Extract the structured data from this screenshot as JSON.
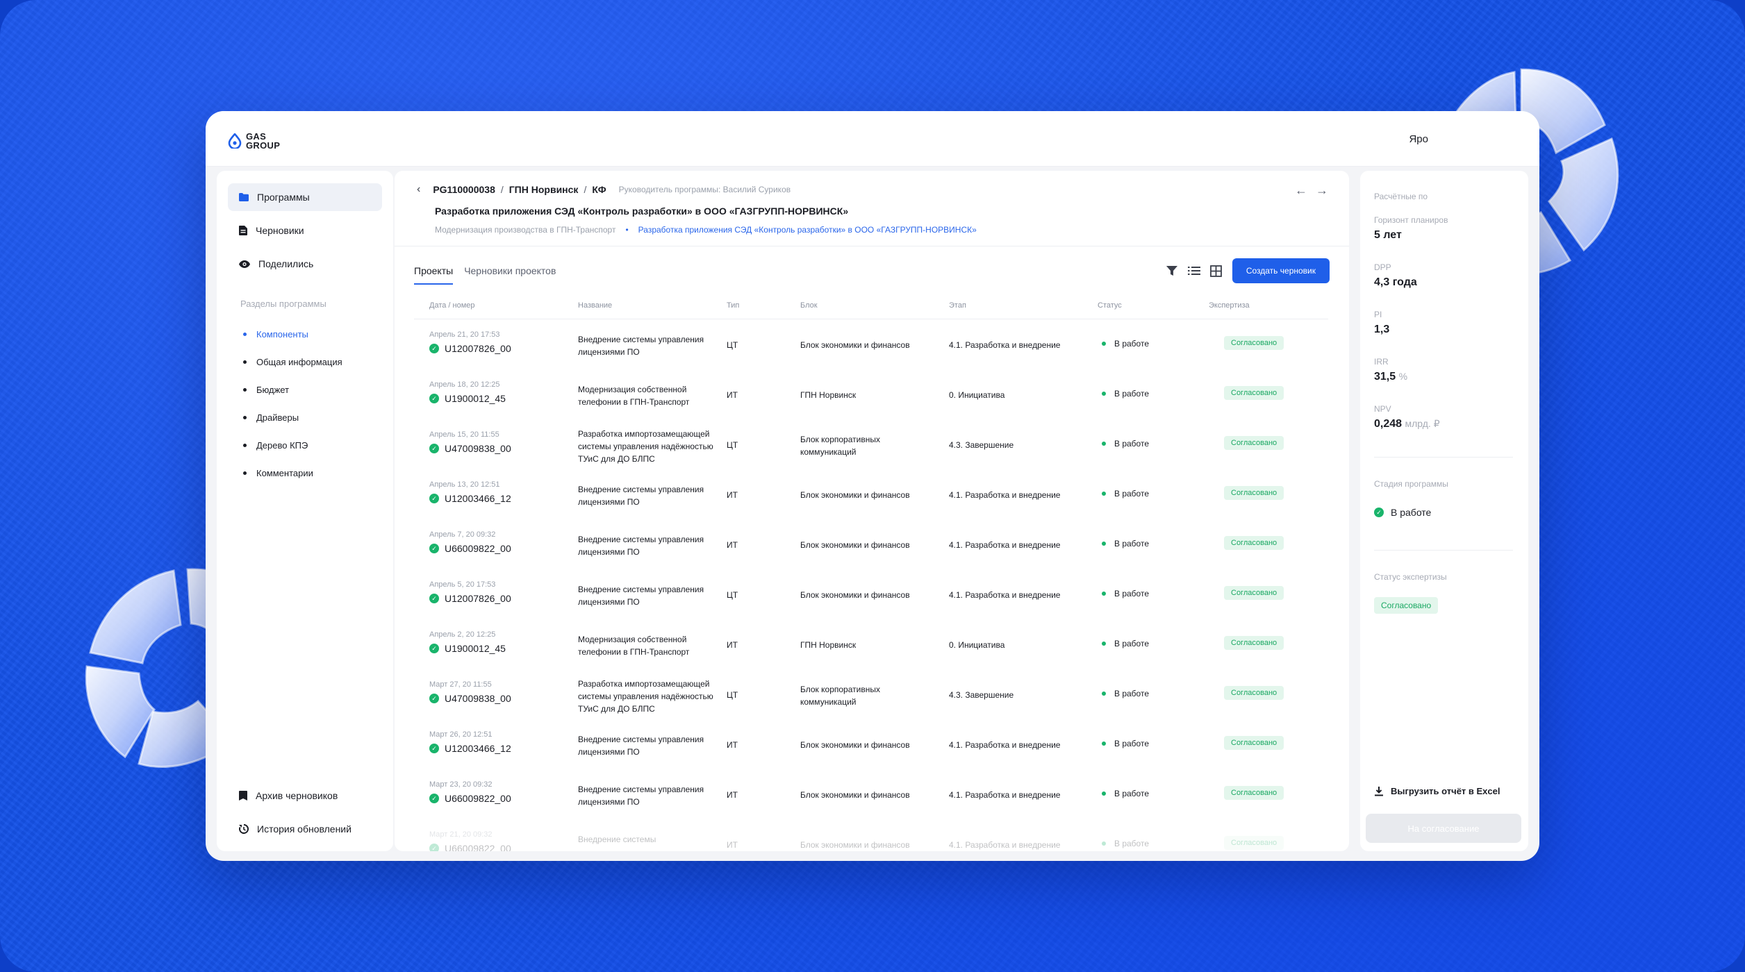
{
  "logo": {
    "text": "GAS\nGROUP"
  },
  "user": {
    "name": "Яро"
  },
  "sidebar": {
    "items": [
      {
        "label": "Программы",
        "icon": "folder-icon"
      },
      {
        "label": "Черновики",
        "icon": "document-icon"
      },
      {
        "label": "Поделились",
        "icon": "eye-icon"
      }
    ],
    "section_caption": "Разделы программы",
    "sections": [
      {
        "label": "Компоненты"
      },
      {
        "label": "Общая информация"
      },
      {
        "label": "Бюджет"
      },
      {
        "label": "Драйверы"
      },
      {
        "label": "Дерево КПЭ"
      },
      {
        "label": "Комментарии"
      }
    ],
    "bottom": [
      {
        "label": "Архив черновиков",
        "icon": "archive-icon"
      },
      {
        "label": "История обновлений",
        "icon": "history-icon"
      }
    ]
  },
  "header": {
    "breadcrumb": [
      "PG110000038",
      "ГПН Норвинск",
      "КФ"
    ],
    "separator": "/",
    "lead": "Руководитель программы: Василий Суриков",
    "title": "Разработка приложения СЭД «Контроль разработки» в ООО «ГАЗГРУПП-НОРВИНСК»",
    "sub_parent": "Модернизация производства в ГПН-Транспорт",
    "sub_link": "Разработка приложения СЭД «Контроль разработки» в ООО «ГАЗГРУПП-НОРВИНСК»"
  },
  "tabs": [
    {
      "label": "Проекты"
    },
    {
      "label": "Черновики проектов"
    }
  ],
  "toolbar": {
    "create_label": "Создать черновик"
  },
  "table": {
    "columns": [
      "Дата / номер",
      "Название",
      "Тип",
      "Блок",
      "Этап",
      "Статус",
      "Экспертиза"
    ],
    "rows": [
      {
        "date": "Апрель 21, 20 17:53",
        "code": "U12007826_00",
        "name": "Внедрение системы управления лицензиями ПО",
        "type": "ЦТ",
        "block": "Блок экономики и финансов",
        "stage": "4.1. Разработка и внедрение",
        "status": "В работе",
        "expertise": "Согласовано"
      },
      {
        "date": "Апрель 18, 20 12:25",
        "code": "U1900012_45",
        "name": "Модернизация собственной телефонии в ГПН-Транспорт",
        "type": "ИТ",
        "block": "ГПН Норвинск",
        "stage": "0. Инициатива",
        "status": "В работе",
        "expertise": "Согласовано"
      },
      {
        "date": "Апрель 15, 20 11:55",
        "code": "U47009838_00",
        "name": "Разработка импортозамещающей системы управления надёжностью ТУиС для ДО БЛПС",
        "type": "ЦТ",
        "block": "Блок корпоративных коммуникаций",
        "stage": "4.3. Завершение",
        "status": "В работе",
        "expertise": "Согласовано"
      },
      {
        "date": "Апрель 13, 20 12:51",
        "code": "U12003466_12",
        "name": "Внедрение системы управления лицензиями ПО",
        "type": "ИТ",
        "block": "Блок экономики и финансов",
        "stage": "4.1. Разработка и внедрение",
        "status": "В работе",
        "expertise": "Согласовано"
      },
      {
        "date": "Апрель 7, 20 09:32",
        "code": "U66009822_00",
        "name": "Внедрение системы управления лицензиями ПО",
        "type": "ИТ",
        "block": "Блок экономики и финансов",
        "stage": "4.1. Разработка и внедрение",
        "status": "В работе",
        "expertise": "Согласовано"
      },
      {
        "date": "Апрель 5, 20 17:53",
        "code": "U12007826_00",
        "name": "Внедрение системы управления лицензиями ПО",
        "type": "ЦТ",
        "block": "Блок экономики и финансов",
        "stage": "4.1. Разработка и внедрение",
        "status": "В работе",
        "expertise": "Согласовано"
      },
      {
        "date": "Апрель 2, 20 12:25",
        "code": "U1900012_45",
        "name": "Модернизация собственной телефонии в ГПН-Транспорт",
        "type": "ИТ",
        "block": "ГПН Норвинск",
        "stage": "0. Инициатива",
        "status": "В работе",
        "expertise": "Согласовано"
      },
      {
        "date": "Март 27, 20 11:55",
        "code": "U47009838_00",
        "name": "Разработка импортозамещающей системы управления надёжностью ТУиС для ДО БЛПС",
        "type": "ЦТ",
        "block": "Блок корпоративных коммуникаций",
        "stage": "4.3. Завершение",
        "status": "В работе",
        "expertise": "Согласовано"
      },
      {
        "date": "Март 26, 20 12:51",
        "code": "U12003466_12",
        "name": "Внедрение системы управления лицензиями ПО",
        "type": "ИТ",
        "block": "Блок экономики и финансов",
        "stage": "4.1. Разработка и внедрение",
        "status": "В работе",
        "expertise": "Согласовано"
      },
      {
        "date": "Март 23, 20 09:32",
        "code": "U66009822_00",
        "name": "Внедрение системы управления лицензиями ПО",
        "type": "ИТ",
        "block": "Блок экономики и финансов",
        "stage": "4.1. Разработка и внедрение",
        "status": "В работе",
        "expertise": "Согласовано"
      },
      {
        "date": "Март 21, 20 09:32",
        "code": "U66009822_00",
        "name": "Внедрение системы",
        "type": "ИТ",
        "block": "Блок экономики и финансов",
        "stage": "4.1. Разработка и внедрение",
        "status": "В работе",
        "expertise": "Согласовано"
      }
    ]
  },
  "right": {
    "calc_label": "Расчётные по",
    "metrics": [
      {
        "label": "Горизонт планиров",
        "value": "5 лет",
        "unit": ""
      },
      {
        "label": "DPP",
        "value": "4,3 года",
        "unit": ""
      },
      {
        "label": "PI",
        "value": "1,3",
        "unit": ""
      },
      {
        "label": "IRR",
        "value": "31,5",
        "unit": "%"
      },
      {
        "label": "NPV",
        "value": "0,248",
        "unit": "млрд. ₽"
      }
    ],
    "stage_label": "Стадия программы",
    "stage_value": "В работе",
    "expertise_label": "Статус экспертизы",
    "expertise_value": "Согласовано",
    "excel_label": "Выгрузить отчёт в Excel",
    "approve_label": "На согласование"
  },
  "colors": {
    "accent": "#1f5fe9",
    "success": "#19b46b",
    "background": "#1552e8"
  }
}
